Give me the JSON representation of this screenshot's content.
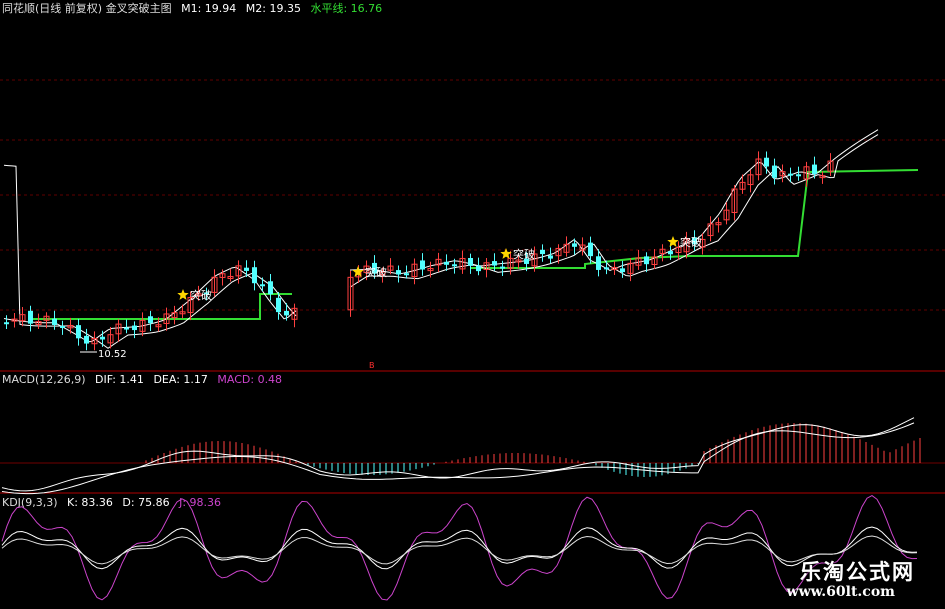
{
  "main_panel": {
    "title": "同花顺(日线 前复权) 金叉突破主图",
    "m1": "M1: 19.94",
    "m2": "M2: 19.35",
    "level": "水平线: 16.76",
    "low_label": "10.52",
    "signal_label": "突破",
    "red_marker": "B"
  },
  "macd_panel": {
    "title": "MACD(12,26,9)",
    "dif": "DIF: 1.41",
    "dea": "DEA: 1.17",
    "macd": "MACD: 0.48"
  },
  "kdj_panel": {
    "title": "KDJ(9,3,3)",
    "k": "K: 83.36",
    "d": "D: 75.86",
    "j": "J: 98.36"
  },
  "watermark": {
    "name": "乐淘公式网",
    "url": "www.60lt.com"
  },
  "colors": {
    "up": "#ff4040",
    "down": "#54ffff",
    "level_line": "#33dd33",
    "ma": "#ffffff",
    "j_line": "#cc44cc",
    "separator": "#b00000",
    "star": "#ffd700"
  }
}
